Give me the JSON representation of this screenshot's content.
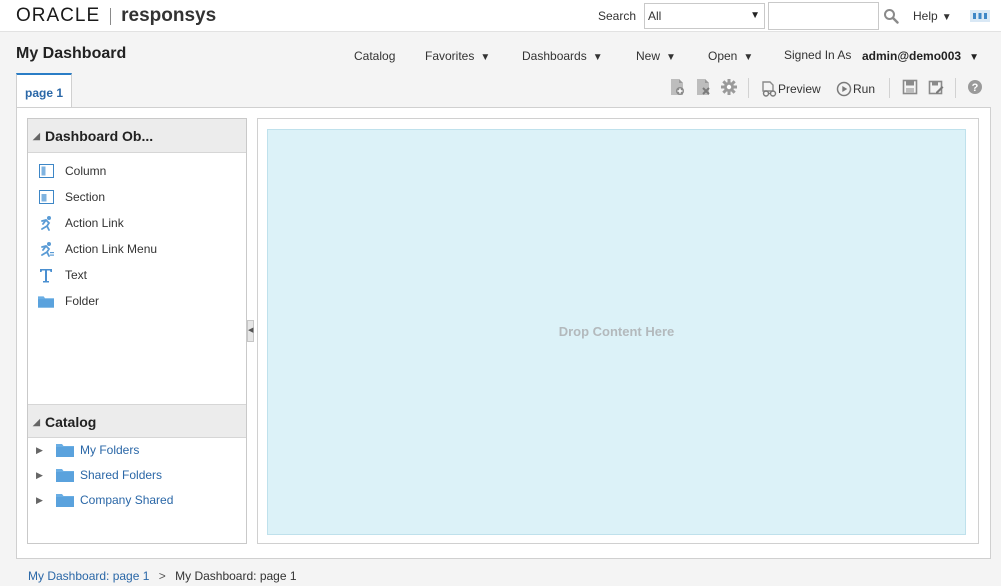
{
  "header": {
    "brand_oracle": "ORACLE",
    "brand_product": "responsys",
    "search_label": "Search",
    "search_scope": "All",
    "search_value": "",
    "help_label": "Help"
  },
  "title_bar": {
    "page_title": "My Dashboard",
    "menu": [
      "Catalog",
      "Favorites",
      "Dashboards",
      "New",
      "Open"
    ],
    "signed_in_label": "Signed In As",
    "signed_in_user": "admin@demo003"
  },
  "toolbar": {
    "preview_label": "Preview",
    "run_label": "Run"
  },
  "tabs": [
    {
      "label": "page 1",
      "active": true
    }
  ],
  "dashboard_objects": {
    "title": "Dashboard Ob...",
    "items": [
      {
        "label": "Column",
        "icon": "column-icon"
      },
      {
        "label": "Section",
        "icon": "section-icon"
      },
      {
        "label": "Action Link",
        "icon": "action-link-icon"
      },
      {
        "label": "Action Link Menu",
        "icon": "action-link-menu-icon"
      },
      {
        "label": "Text",
        "icon": "text-icon"
      },
      {
        "label": "Folder",
        "icon": "folder-icon"
      }
    ]
  },
  "catalog": {
    "title": "Catalog",
    "items": [
      {
        "label": "My Folders"
      },
      {
        "label": "Shared Folders"
      },
      {
        "label": "Company Shared"
      }
    ]
  },
  "canvas": {
    "drop_text": "Drop Content Here"
  },
  "breadcrumb": {
    "link": "My Dashboard: page 1",
    "separator": ">",
    "current": "My Dashboard: page 1"
  },
  "colors": {
    "accent": "#2a67a7",
    "drop_zone": "#dcf2f8",
    "tab_top_border": "#2a7dc6"
  }
}
